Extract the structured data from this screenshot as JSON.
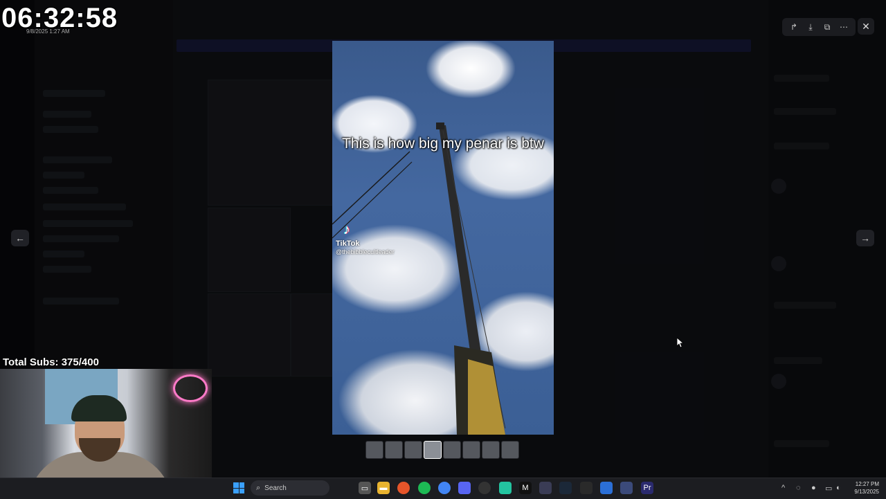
{
  "stream": {
    "timer": "06:32:58",
    "timer_date": "9/8/2025 1:27 AM",
    "subs_label": "Total Subs: 375/400"
  },
  "viewer": {
    "caption": "This is how big my penar is btw",
    "tiktok_brand": "TikTok",
    "tiktok_handle": "@thebibblecultleader",
    "prev_icon": "arrow-left-icon",
    "next_icon": "arrow-right-icon",
    "tools": [
      "forward-icon",
      "download-icon",
      "open-external-icon",
      "more-icon"
    ],
    "close_icon": "close-icon",
    "thumbnails_count": 8,
    "active_thumbnail": 4
  },
  "taskbar": {
    "search_placeholder": "Search",
    "time": "12:27 PM",
    "date": "9/13/2025",
    "apps": [
      "file-explorer-icon",
      "firefox-icon",
      "spotify-icon",
      "chrome-icon",
      "discord-icon",
      "obs-icon",
      "discord-alt-icon",
      "capcut-icon",
      "app-icon",
      "steam-icon",
      "epic-icon",
      "app-blue-icon",
      "app-globe-icon",
      "premiere-icon"
    ]
  },
  "colors": {
    "accent_blue": "#3aa0ff",
    "premiere": "#2a2a6e",
    "spotify": "#1db954"
  }
}
